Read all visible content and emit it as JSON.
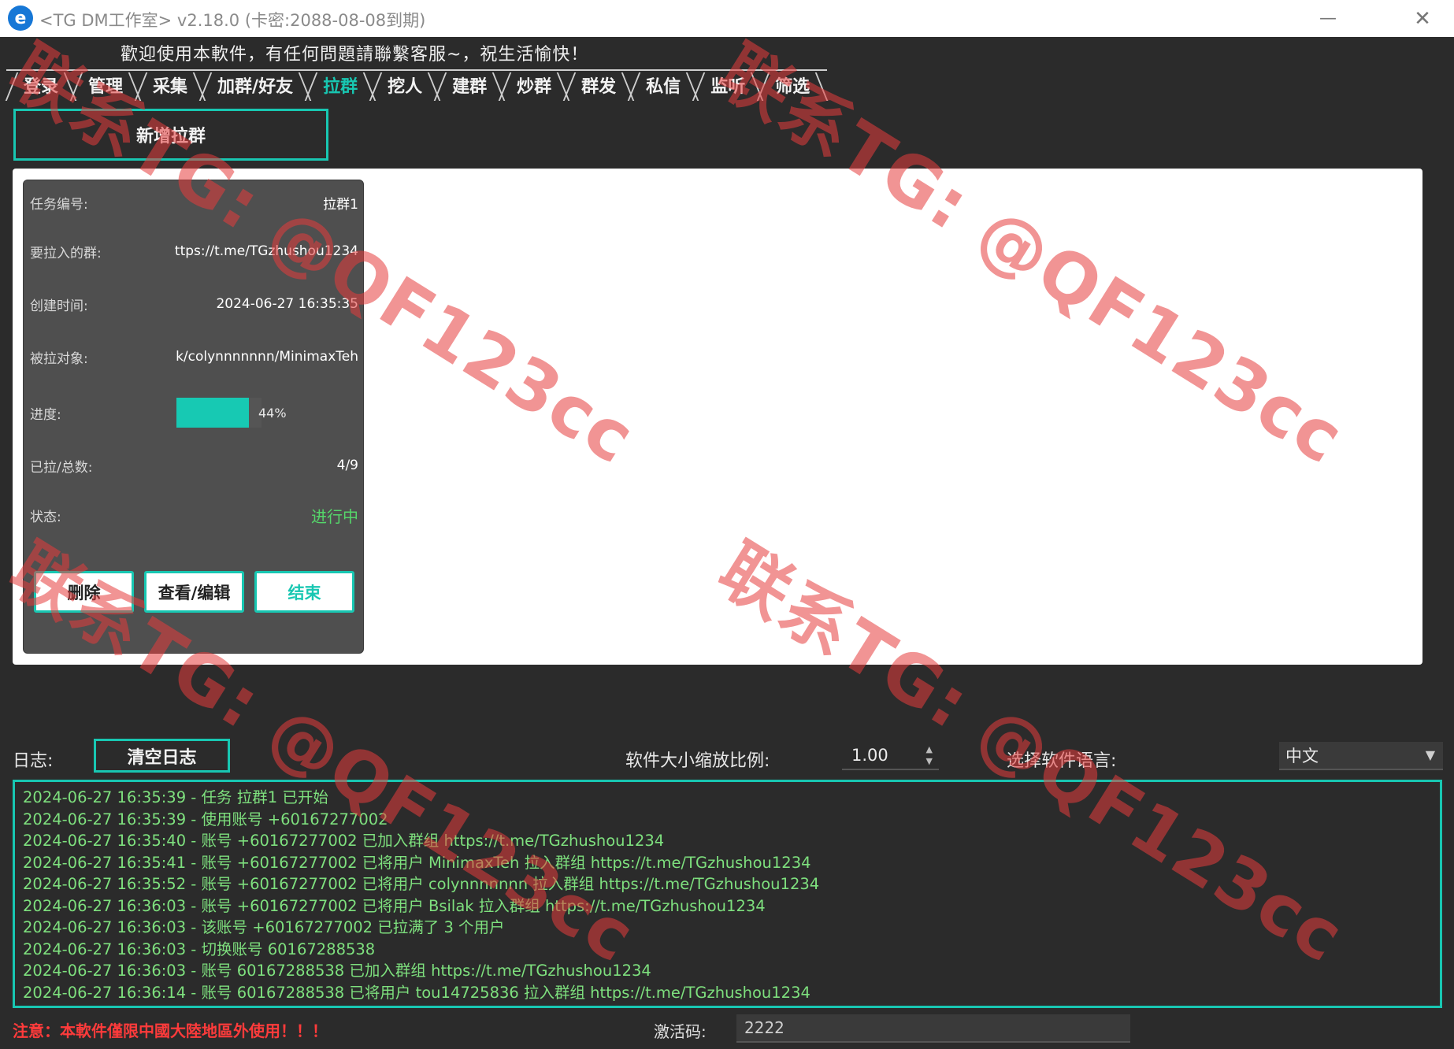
{
  "titlebar": {
    "title": "<TG DM工作室> v2.18.0 (卡密:2088-08-08到期)",
    "minimize_glyph": "—",
    "close_glyph": "✕"
  },
  "welcome": "歡迎使用本軟件，有任何問題請聯繫客服~，祝生活愉快！",
  "tabs": [
    {
      "label": "登录",
      "active": false
    },
    {
      "label": "管理",
      "active": false
    },
    {
      "label": "采集",
      "active": false
    },
    {
      "label": "加群/好友",
      "active": false
    },
    {
      "label": "拉群",
      "active": true
    },
    {
      "label": "挖人",
      "active": false
    },
    {
      "label": "建群",
      "active": false
    },
    {
      "label": "炒群",
      "active": false
    },
    {
      "label": "群发",
      "active": false
    },
    {
      "label": "私信",
      "active": false
    },
    {
      "label": "监听",
      "active": false
    },
    {
      "label": "筛选",
      "active": false
    }
  ],
  "new_button": "新增拉群",
  "task": {
    "id_label": "任务编号:",
    "id_value": "拉群1",
    "group_label": "要拉入的群:",
    "group_value": "ttps://t.me/TGzhushou1234",
    "created_label": "创建时间:",
    "created_value": "2024-06-27 16:35:35",
    "target_label": "被拉对象:",
    "target_value": "k/colynnnnnnn/MinimaxTeh",
    "progress_label": "进度:",
    "progress_percent": 44,
    "progress_text": "44%",
    "pulled_label": "已拉/总数:",
    "pulled_value": "4/9",
    "status_label": "状态:",
    "status_value": "进行中",
    "buttons": {
      "delete": "删除",
      "view_edit": "查看/编辑",
      "end": "结束"
    }
  },
  "log": {
    "label": "日志:",
    "clear_button": "清空日志",
    "lines": [
      "2024-06-27 16:35:39 - 任务 拉群1 已开始",
      "2024-06-27 16:35:39 - 使用账号 +60167277002",
      "2024-06-27 16:35:40 - 账号 +60167277002 已加入群组 https://t.me/TGzhushou1234",
      "2024-06-27 16:35:41 - 账号 +60167277002 已将用户 MinimaxTeh 拉入群组 https://t.me/TGzhushou1234",
      "2024-06-27 16:35:52 - 账号 +60167277002 已将用户 colynnnnnnn 拉入群组 https://t.me/TGzhushou1234",
      "2024-06-27 16:36:03 - 账号 +60167277002 已将用户 Bsilak 拉入群组 https://t.me/TGzhushou1234",
      "2024-06-27 16:36:03 - 该账号 +60167277002 已拉满了 3 个用户",
      "2024-06-27 16:36:03 - 切换账号 60167288538",
      "2024-06-27 16:36:03 - 账号 60167288538 已加入群组 https://t.me/TGzhushou1234",
      "2024-06-27 16:36:14 - 账号 60167288538 已将用户 tou14725836 拉入群组 https://t.me/TGzhushou1234"
    ]
  },
  "scale": {
    "label": "软件大小缩放比例:",
    "value": "1.00"
  },
  "language": {
    "label": "选择软件语言:",
    "value": "中文"
  },
  "footer": {
    "warning": "注意：本軟件僅限中國大陸地區外使用！！！",
    "activation_label": "激活码:",
    "activation_value": "2222"
  },
  "watermark": "联系TG: @QF123cc",
  "colors": {
    "accent": "#18c7b2",
    "log_text": "#7ee07e",
    "warning": "#ff3b3b",
    "watermark": "#e63c3c"
  }
}
